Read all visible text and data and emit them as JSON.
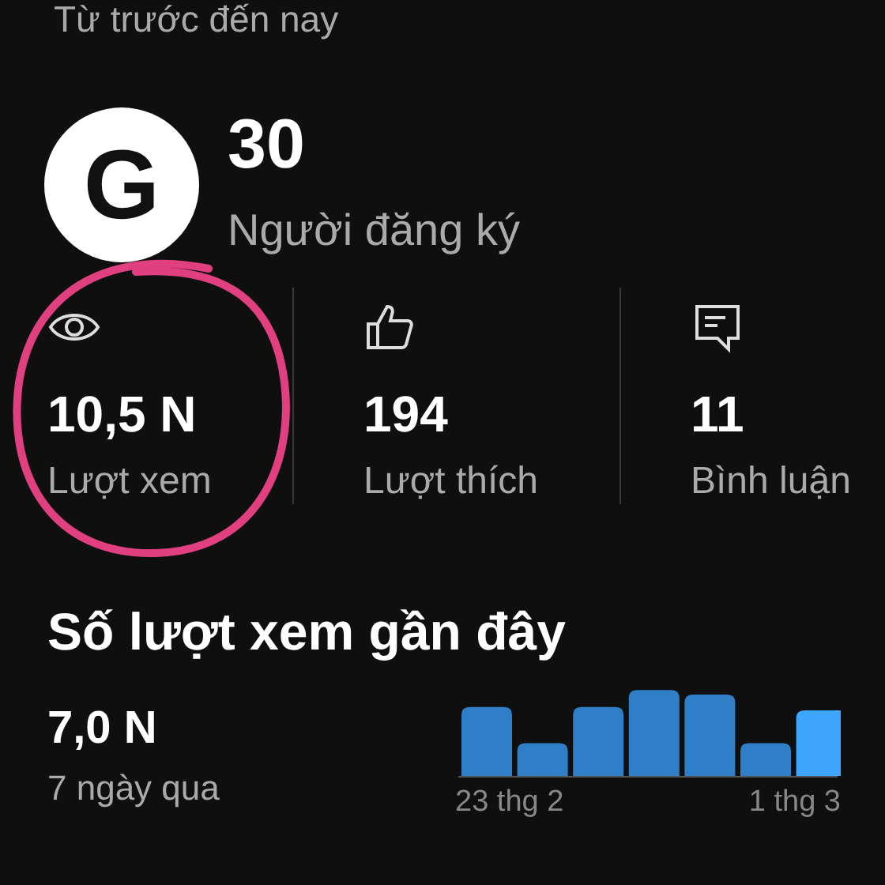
{
  "header": {
    "subtitle": "Từ trước đến nay"
  },
  "channel": {
    "avatar_letter": "G",
    "subscriber_count": "30",
    "subscriber_label": "Người đăng ký"
  },
  "stats": [
    {
      "kind": "views",
      "value": "10,5 N",
      "label": "Lượt xem"
    },
    {
      "kind": "likes",
      "value": "194",
      "label": "Lượt thích"
    },
    {
      "kind": "comments",
      "value": "11",
      "label": "Bình luận"
    }
  ],
  "recent": {
    "title": "Số lượt xem gần đây",
    "value": "7,0 N",
    "period": "7 ngày qua",
    "chart": {
      "start_label": "23 thg 2",
      "end_label": "1 thg 3"
    }
  }
}
